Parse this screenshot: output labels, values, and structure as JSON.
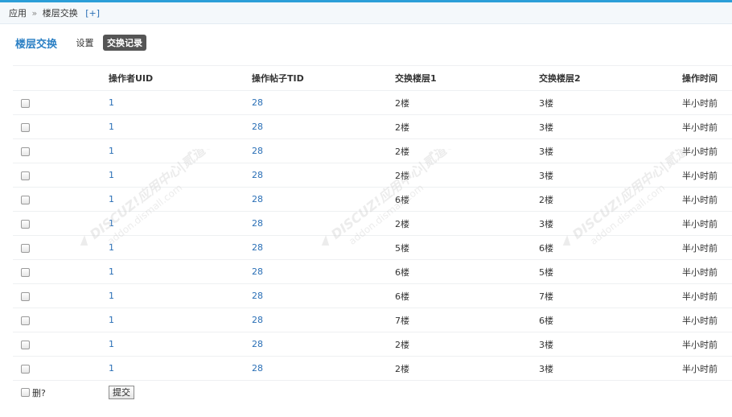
{
  "breadcrumb": {
    "app": "应用",
    "separator": "»",
    "current": "楼层交换",
    "add": "[+]"
  },
  "page": {
    "title": "楼层交换",
    "tabs": [
      {
        "label": "设置",
        "active": false
      },
      {
        "label": "交换记录",
        "active": true
      }
    ]
  },
  "table": {
    "headers": [
      "",
      "操作者UID",
      "操作帖子TID",
      "交换楼层1",
      "交换楼层2",
      "操作时间"
    ],
    "rows": [
      {
        "uid": "1",
        "tid": "28",
        "floor1": "2楼",
        "floor2": "3楼",
        "time": "半小时前"
      },
      {
        "uid": "1",
        "tid": "28",
        "floor1": "2楼",
        "floor2": "3楼",
        "time": "半小时前"
      },
      {
        "uid": "1",
        "tid": "28",
        "floor1": "2楼",
        "floor2": "3楼",
        "time": "半小时前"
      },
      {
        "uid": "1",
        "tid": "28",
        "floor1": "2楼",
        "floor2": "3楼",
        "time": "半小时前"
      },
      {
        "uid": "1",
        "tid": "28",
        "floor1": "6楼",
        "floor2": "2楼",
        "time": "半小时前"
      },
      {
        "uid": "1",
        "tid": "28",
        "floor1": "2楼",
        "floor2": "3楼",
        "time": "半小时前"
      },
      {
        "uid": "1",
        "tid": "28",
        "floor1": "5楼",
        "floor2": "6楼",
        "time": "半小时前"
      },
      {
        "uid": "1",
        "tid": "28",
        "floor1": "6楼",
        "floor2": "5楼",
        "time": "半小时前"
      },
      {
        "uid": "1",
        "tid": "28",
        "floor1": "6楼",
        "floor2": "7楼",
        "time": "半小时前"
      },
      {
        "uid": "1",
        "tid": "28",
        "floor1": "7楼",
        "floor2": "6楼",
        "time": "半小时前"
      },
      {
        "uid": "1",
        "tid": "28",
        "floor1": "2楼",
        "floor2": "3楼",
        "time": "半小时前"
      },
      {
        "uid": "1",
        "tid": "28",
        "floor1": "2楼",
        "floor2": "3楼",
        "time": "半小时前"
      }
    ]
  },
  "footer": {
    "delete_label": "删?",
    "submit_label": "提交"
  },
  "watermark": {
    "line1": "DISCUZ!应用中心|贰道®",
    "line2": "addon.dismall.com"
  },
  "colors": {
    "accent": "#2b9ed8",
    "link": "#2a6fb6",
    "title": "#2a7fc4",
    "active_tab_bg": "#555555"
  }
}
